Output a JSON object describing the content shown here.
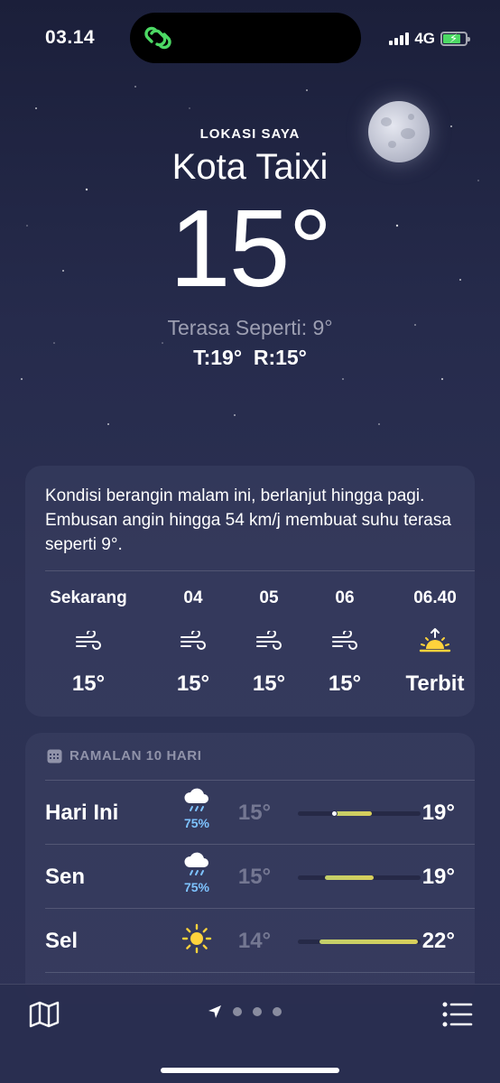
{
  "status": {
    "time": "03.14",
    "network": "4G",
    "battery_color": "#4cd964"
  },
  "hero": {
    "location_label": "LOKASI SAYA",
    "city": "Kota Taixi",
    "temperature": "15°",
    "feels_like": "Terasa Seperti: 9°",
    "high_low": "T:19°  R:15°"
  },
  "hourly": {
    "summary": "Kondisi berangin malam ini, berlanjut hingga pagi. Embusan angin hingga 54 km/j membuat suhu terasa seperti 9°.",
    "items": [
      {
        "label": "Sekarang",
        "icon": "wind-icon",
        "temp": "15°"
      },
      {
        "label": "04",
        "icon": "wind-icon",
        "temp": "15°"
      },
      {
        "label": "05",
        "icon": "wind-icon",
        "temp": "15°"
      },
      {
        "label": "06",
        "icon": "wind-icon",
        "temp": "15°"
      },
      {
        "label": "06.40",
        "icon": "sunrise-icon",
        "temp": "Terbit"
      }
    ]
  },
  "daily": {
    "header": "RAMALAN 10 HARI",
    "header_icon": "calendar-icon",
    "days": [
      {
        "name": "Hari Ini",
        "icon": "rain-cloud-icon",
        "precip": "75%",
        "low": "15°",
        "high": "19°",
        "bar_start": 0.28,
        "bar_end": 0.6,
        "current": 0.3
      },
      {
        "name": "Sen",
        "icon": "rain-cloud-icon",
        "precip": "75%",
        "low": "15°",
        "high": "19°",
        "bar_start": 0.22,
        "bar_end": 0.62
      },
      {
        "name": "Sel",
        "icon": "sun-icon",
        "precip": "",
        "low": "14°",
        "high": "22°",
        "bar_start": 0.18,
        "bar_end": 0.98
      }
    ]
  },
  "toolbar": {
    "map_icon": "map-icon",
    "location_icon": "location-arrow-icon",
    "list_icon": "list-icon",
    "page_dots": 3
  }
}
